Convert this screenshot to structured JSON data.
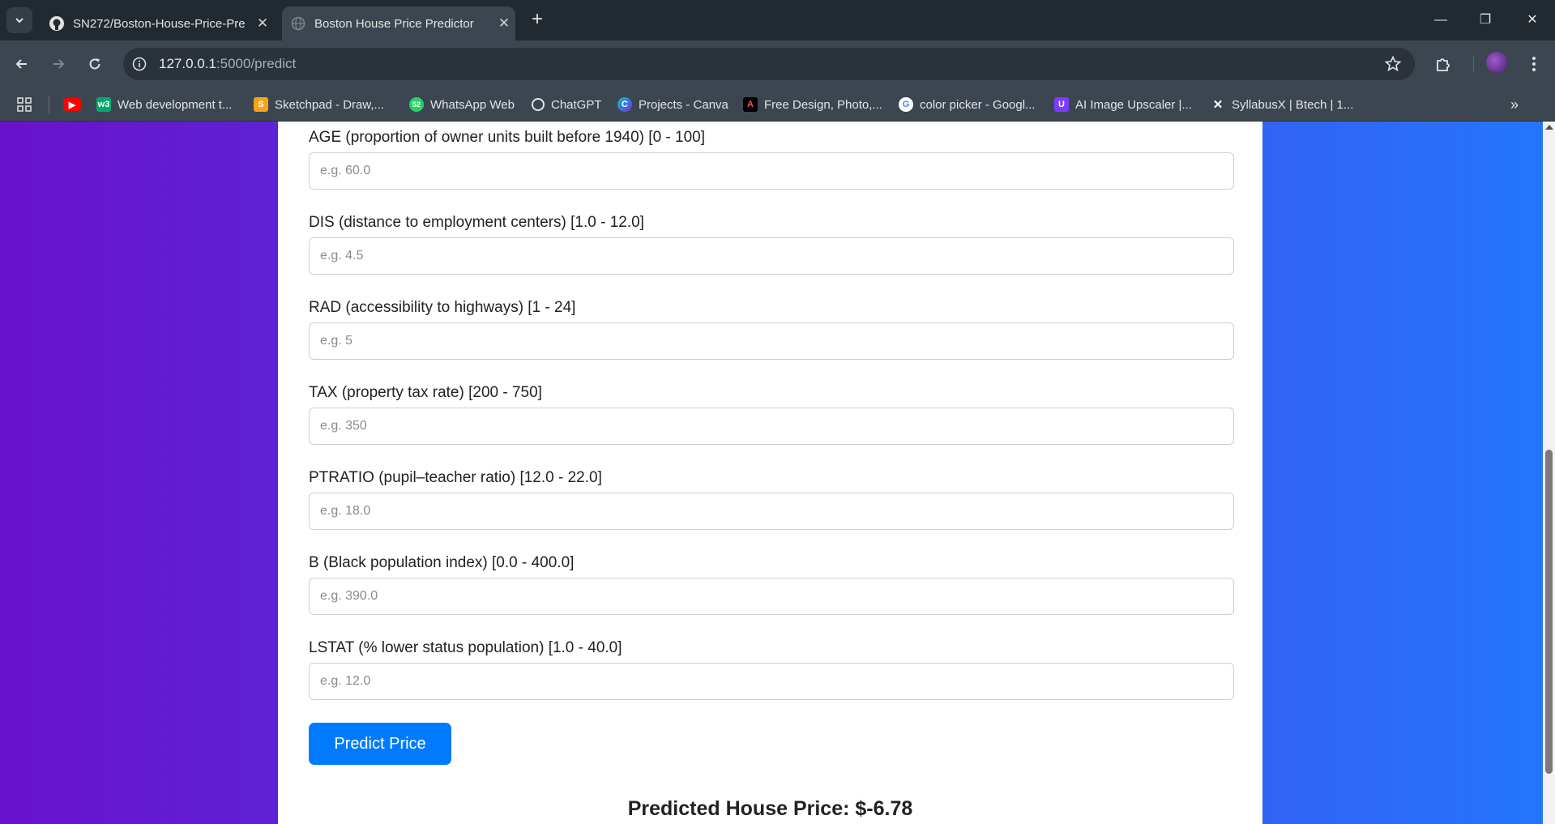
{
  "browser": {
    "tabs": [
      {
        "title": "SN272/Boston-House-Price-Pre",
        "favicon": "github-icon",
        "active": false
      },
      {
        "title": "Boston House Price Predictor",
        "favicon": "globe-icon",
        "active": true
      }
    ],
    "url_host": "127.0.0.1",
    "url_path": ":5000/predict",
    "bookmarks": [
      {
        "label": "Web development t...",
        "icon": "w3schools-icon",
        "color": "#04aa6d"
      },
      {
        "label": "Sketchpad - Draw,...",
        "icon": "sketchpad-icon",
        "color": "#f7a21b"
      },
      {
        "label": "WhatsApp Web",
        "icon": "whatsapp-icon",
        "color": "#25d366"
      },
      {
        "label": "ChatGPT",
        "icon": "chatgpt-icon",
        "color": "#ffffff"
      },
      {
        "label": "Projects - Canva",
        "icon": "canva-icon",
        "color": "#00c4cc"
      },
      {
        "label": "Free Design, Photo,...",
        "icon": "adobe-express-icon",
        "color": "#000000"
      },
      {
        "label": "color picker - Googl...",
        "icon": "google-icon",
        "color": "#ffffff"
      },
      {
        "label": "AI Image Upscaler |...",
        "icon": "upscaler-icon",
        "color": "#7a3cff"
      },
      {
        "label": "SyllabusX | Btech | 1...",
        "icon": "x-icon",
        "color": "#000000"
      }
    ],
    "whatsapp_badge": "52"
  },
  "form": {
    "fields": [
      {
        "label": "AGE (proportion of owner units built before 1940) [0 - 100]",
        "placeholder": "e.g. 60.0"
      },
      {
        "label": "DIS (distance to employment centers) [1.0 - 12.0]",
        "placeholder": "e.g. 4.5"
      },
      {
        "label": "RAD (accessibility to highways) [1 - 24]",
        "placeholder": "e.g. 5"
      },
      {
        "label": "TAX (property tax rate) [200 - 750]",
        "placeholder": "e.g. 350"
      },
      {
        "label": "PTRATIO (pupil–teacher ratio) [12.0 - 22.0]",
        "placeholder": "e.g. 18.0"
      },
      {
        "label": "B (Black population index) [0.0 - 400.0]",
        "placeholder": "e.g. 390.0"
      },
      {
        "label": "LSTAT (% lower status population) [1.0 - 40.0]",
        "placeholder": "e.g. 12.0"
      }
    ],
    "submit_label": "Predict Price"
  },
  "result": {
    "text": "Predicted House Price: $-6.78"
  },
  "colors": {
    "gradient_start": "#6a11cb",
    "gradient_end": "#2575fc",
    "button": "#007bff"
  }
}
